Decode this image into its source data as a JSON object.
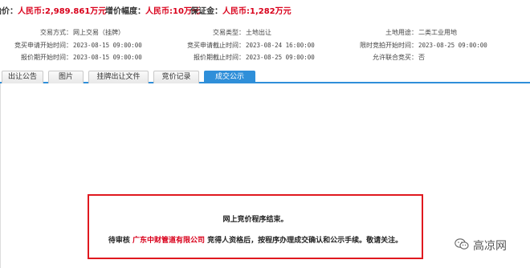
{
  "price_bar": {
    "start_price_label": "起始价：",
    "start_price_value": "人民币:2,989.861万元",
    "increment_label": "增价幅度：",
    "increment_value": "人民币:10万元",
    "deposit_label": "保证金：",
    "deposit_value": "人民币:1,282万元"
  },
  "info": {
    "row1": {
      "trade_method_label": "交易方式：",
      "trade_method_value": "网上交易（挂牌）",
      "trade_type_label": "交易类型：",
      "trade_type_value": "土地出让",
      "land_use_label": "土地用途：",
      "land_use_value": "二类工业用地"
    },
    "row2": {
      "apply_start_label": "竞买申请开始时间：",
      "apply_start_value": "2023-08-15 09:00:00",
      "apply_end_label": "竞买申请截止时间：",
      "apply_end_value": "2023-08-24 16:00:00",
      "timed_bid_start_label": "限时竞拍开始时间：",
      "timed_bid_start_value": "2023-08-25 09:00:00"
    },
    "row3": {
      "quote_start_label": "报价期开始时间：",
      "quote_start_value": "2023-08-15 09:00:00",
      "quote_end_label": "报价期截止时间：",
      "quote_end_value": "2023-08-25 09:00:00",
      "joint_bid_label": "允许联合竞买：",
      "joint_bid_value": "否"
    }
  },
  "tabs": [
    {
      "label": "出让公告"
    },
    {
      "label": "图片"
    },
    {
      "label": "挂牌出让文件"
    },
    {
      "label": "竞价记录"
    },
    {
      "label": "成交公示"
    }
  ],
  "notice": {
    "line1": "网上竞价程序结束。",
    "line2_prefix": "待审核",
    "company": "广东中财管道有限公司",
    "line2_suffix": "竞得人资格后，按程序办理成交确认和公示手续。敬请关注。"
  },
  "watermark": {
    "icon": "wechat-icon",
    "text": "高凉网"
  },
  "colors": {
    "accent": "#2f8fd9",
    "price_red": "#d9001b",
    "border_red": "#e0191f"
  }
}
